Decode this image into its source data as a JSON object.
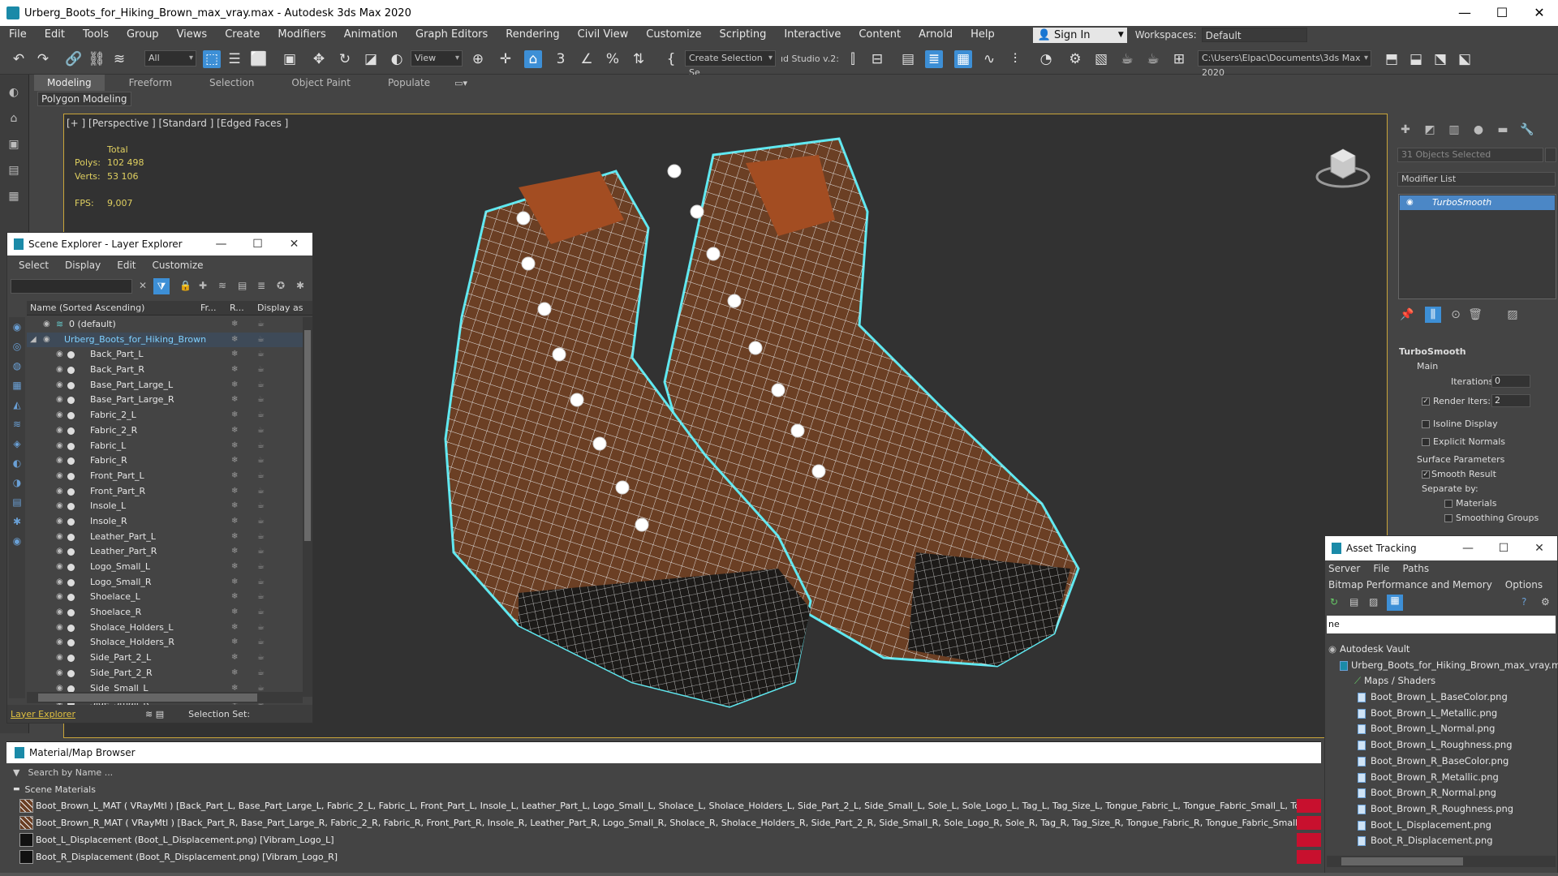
{
  "window": {
    "title": "Urberg_Boots_for_Hiking_Brown_max_vray.max - Autodesk 3ds Max 2020",
    "minimize": "—",
    "maximize": "☐",
    "close": "✕"
  },
  "menubar": {
    "items": [
      "File",
      "Edit",
      "Tools",
      "Group",
      "Views",
      "Create",
      "Modifiers",
      "Animation",
      "Graph Editors",
      "Rendering",
      "Civil View",
      "Customize",
      "Scripting",
      "Interactive",
      "Content",
      "Arnold",
      "Help"
    ],
    "signin": "Sign In",
    "workspaces_label": "Workspaces:",
    "workspaces_value": "Default"
  },
  "toolbar": {
    "selection_filter": "All",
    "ref_coord": "View",
    "create_selection_set": "Create Selection Se",
    "studio_label": "ıd Studio v.2:",
    "project_path": "C:\\Users\\Elpac\\Documents\\3ds Max 2020"
  },
  "ribbon": {
    "tabs": [
      "Modeling",
      "Freeform",
      "Selection",
      "Object Paint",
      "Populate"
    ],
    "active_tab": "Modeling",
    "subpanel": "Polygon Modeling"
  },
  "viewport": {
    "label": "[+ ] [Perspective ] [Standard ] [Edged Faces ]",
    "stats_header": "Total",
    "polys_label": "Polys:",
    "polys_value": "102 498",
    "verts_label": "Verts:",
    "verts_value": "53 106",
    "fps_label": "FPS:",
    "fps_value": "9,007"
  },
  "scene_explorer": {
    "title": "Scene Explorer - Layer Explorer",
    "menu": [
      "Select",
      "Display",
      "Edit",
      "Customize"
    ],
    "columns": [
      "Name (Sorted Ascending)",
      "Fr...",
      "R...",
      "Display as"
    ],
    "layer_default": "0 (default)",
    "layer_main": "Urberg_Boots_for_Hiking_Brown",
    "objects": [
      "Back_Part_L",
      "Back_Part_R",
      "Base_Part_Large_L",
      "Base_Part_Large_R",
      "Fabric_2_L",
      "Fabric_2_R",
      "Fabric_L",
      "Fabric_R",
      "Front_Part_L",
      "Front_Part_R",
      "Insole_L",
      "Insole_R",
      "Leather_Part_L",
      "Leather_Part_R",
      "Logo_Small_L",
      "Logo_Small_R",
      "Shoelace_L",
      "Shoelace_R",
      "Sholace_Holders_L",
      "Sholace_Holders_R",
      "Side_Part_2_L",
      "Side_Part_2_R",
      "Side_Small_L",
      "Side_Small_R"
    ],
    "footer_tab": "Layer Explorer",
    "footer_selset": "Selection Set:"
  },
  "command_panel": {
    "selected": "31 Objects Selected",
    "modifier_list": "Modifier List",
    "modifier": "TurboSmooth",
    "rollout_title": "TurboSmooth",
    "main_label": "Main",
    "iterations_label": "Iterations:",
    "iterations_value": "0",
    "render_iters_label": "Render Iters:",
    "render_iters_value": "2",
    "isoline": "Isoline Display",
    "explicit_normals": "Explicit Normals",
    "surface_params": "Surface Parameters",
    "smooth_result": "Smooth Result",
    "separate_by": "Separate by:",
    "materials": "Materials",
    "smoothing_groups": "Smoothing Groups"
  },
  "asset_tracking": {
    "title": "Asset Tracking",
    "menu1": [
      "Server",
      "File",
      "Paths"
    ],
    "menu2": [
      "Bitmap Performance and Memory",
      "Options"
    ],
    "filter_text": "ne",
    "vault": "Autodesk Vault",
    "file": "Urberg_Boots_for_Hiking_Brown_max_vray.max",
    "maps_folder": "Maps / Shaders",
    "maps": [
      "Boot_Brown_L_BaseColor.png",
      "Boot_Brown_L_Metallic.png",
      "Boot_Brown_L_Normal.png",
      "Boot_Brown_L_Roughness.png",
      "Boot_Brown_R_BaseColor.png",
      "Boot_Brown_R_Metallic.png",
      "Boot_Brown_R_Normal.png",
      "Boot_Brown_R_Roughness.png",
      "Boot_L_Displacement.png",
      "Boot_R_Displacement.png"
    ]
  },
  "material_browser": {
    "title": "Material/Map Browser",
    "search": "Search by Name ...",
    "section": "Scene Materials",
    "rows": [
      "Boot_Brown_L_MAT ( VRayMtl ) [Back_Part_L, Base_Part_Large_L, Fabric_2_L, Fabric_L, Front_Part_L, Insole_L, Leather_Part_L, Logo_Small_L, Sholace_L, Sholace_Holders_L, Side_Part_2_L, Side_Small_L, Sole_L, Sole_Logo_L, Tag_L, Tag_Size_L, Tongue_Fabric_L, Tongue_Fabric_Small_L, Tongue_Leathrer_L, V...",
      "Boot_Brown_R_MAT ( VRayMtl ) [Back_Part_R, Base_Part_Large_R, Fabric_2_R, Fabric_R, Front_Part_R, Insole_R, Leather_Part_R, Logo_Small_R, Sholace_R, Sholace_Holders_R, Side_Part_2_R, Side_Small_R, Sole_Logo_R, Sole_R, Tag_R, Tag_Size_R, Tongue_Fabric_R, Tongue_Fabric_Small_R, Tongue_Leathrer...",
      "Boot_L_Displacement (Boot_L_Displacement.png) [Vibram_Logo_L]",
      "Boot_R_Displacement (Boot_R_Displacement.png) [Vibram_Logo_R]"
    ]
  },
  "colors": {
    "accent": "#3d8fd6",
    "viewport_border": "#c9a53a",
    "wire": "#ffffff",
    "selection_outline": "#5fe8f0",
    "leather": "#6b3f24",
    "sole": "#1c1a18"
  }
}
